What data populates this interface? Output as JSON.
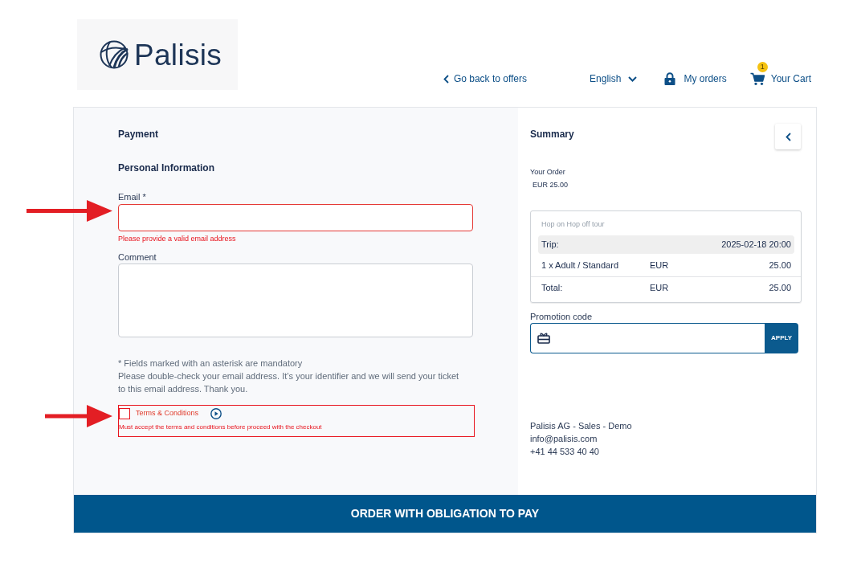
{
  "header": {
    "logo": {
      "text": "Palisis"
    },
    "nav": [
      {
        "kind": "back",
        "label": "Go back to offers"
      },
      {
        "kind": "language",
        "label": "English"
      },
      {
        "kind": "orders",
        "label": "My orders"
      },
      {
        "kind": "cart",
        "label": "Your Cart",
        "badge": "1"
      }
    ]
  },
  "payment": {
    "title": "Payment",
    "section_title": "Personal Information",
    "fields": [
      {
        "kind": "input",
        "label": "Email *",
        "invalid": true,
        "error": "Please provide a valid email address"
      },
      {
        "kind": "textarea",
        "label": "Comment",
        "invalid": false
      }
    ],
    "notes": [
      "* Fields marked with an asterisk are mandatory",
      "Please double-check your email address. It’s your identifier and we will send your ticket to this email address. Thank you."
    ],
    "terms": {
      "label": "Terms & Conditions",
      "checked": false,
      "invalid": true,
      "error": "Must accept the terms and conditions before proceed with the checkout"
    }
  },
  "summary": {
    "title": "Summary",
    "order_label": "Your Order",
    "order_total": "EUR 25.00",
    "tour": {
      "name": "Hop on Hop off tour",
      "trip_label": "Trip:",
      "trip_date": "2025-02-18 20:00",
      "lines": [
        {
          "description": "1 x Adult / Standard",
          "currency": "EUR",
          "amount": "25.00"
        }
      ],
      "total": {
        "label": "Total:",
        "currency": "EUR",
        "amount": "25.00"
      }
    },
    "promotion": {
      "label": "Promotion code",
      "button": "APPLY"
    },
    "contact": [
      "Palisis AG - Sales - Demo",
      "info@palisis.com",
      "+41 44 533 40 40"
    ]
  },
  "order_button": "ORDER WITH OBLIGATION TO PAY"
}
